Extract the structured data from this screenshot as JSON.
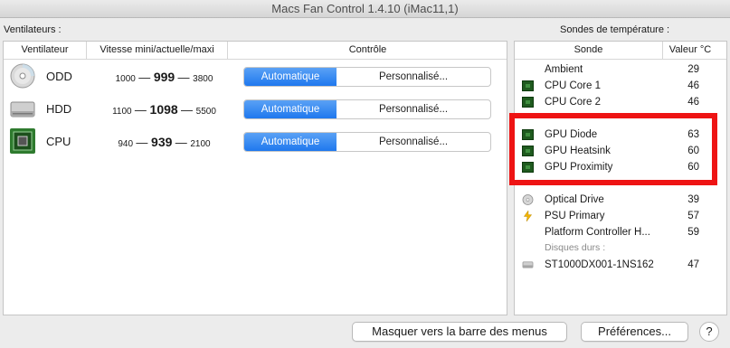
{
  "window": {
    "title": "Macs Fan Control 1.4.10 (iMac11,1)"
  },
  "fans_section": {
    "label": "Ventilateurs :",
    "columns": {
      "fan": "Ventilateur",
      "speed": "Vitesse mini/actuelle/maxi",
      "control": "Contrôle"
    },
    "rows": [
      {
        "name": "ODD",
        "icon": "optical-disc-icon",
        "min": "1000",
        "current": "999",
        "max": "3800",
        "auto_label": "Automatique",
        "custom_label": "Personnalisé..."
      },
      {
        "name": "HDD",
        "icon": "hard-drive-icon",
        "min": "1100",
        "current": "1098",
        "max": "5500",
        "auto_label": "Automatique",
        "custom_label": "Personnalisé..."
      },
      {
        "name": "CPU",
        "icon": "chip-icon",
        "min": "940",
        "current": "939",
        "max": "2100",
        "auto_label": "Automatique",
        "custom_label": "Personnalisé..."
      }
    ]
  },
  "temps_section": {
    "label": "Sondes de température :",
    "columns": {
      "sensor": "Sonde",
      "value": "Valeur °C"
    },
    "rows": [
      {
        "name": "Ambient",
        "value": "29",
        "icon": ""
      },
      {
        "name": "CPU Core 1",
        "value": "46",
        "icon": "chip-icon"
      },
      {
        "name": "CPU Core 2",
        "value": "46",
        "icon": "chip-icon"
      },
      {
        "name": "GPU Diode",
        "value": "63",
        "icon": "gpu-card-icon"
      },
      {
        "name": "GPU Heatsink",
        "value": "60",
        "icon": "gpu-card-icon"
      },
      {
        "name": "GPU Proximity",
        "value": "60",
        "icon": "gpu-card-icon"
      },
      {
        "name": "Optical Drive",
        "value": "39",
        "icon": "optical-disc-icon"
      },
      {
        "name": "PSU Primary",
        "value": "57",
        "icon": "lightning-icon"
      },
      {
        "name": "Platform Controller H...",
        "value": "59",
        "icon": ""
      },
      {
        "name": "ST1000DX001-1NS162",
        "value": "47",
        "icon": "hard-drive-icon"
      }
    ],
    "group_hdd": "Disques durs :"
  },
  "buttons": {
    "hide_to_menubar": "Masquer vers la barre des menus",
    "preferences": "Préférences...",
    "help": "?"
  },
  "colors": {
    "accent": "#1f78ee",
    "highlight": "#ee1414"
  }
}
